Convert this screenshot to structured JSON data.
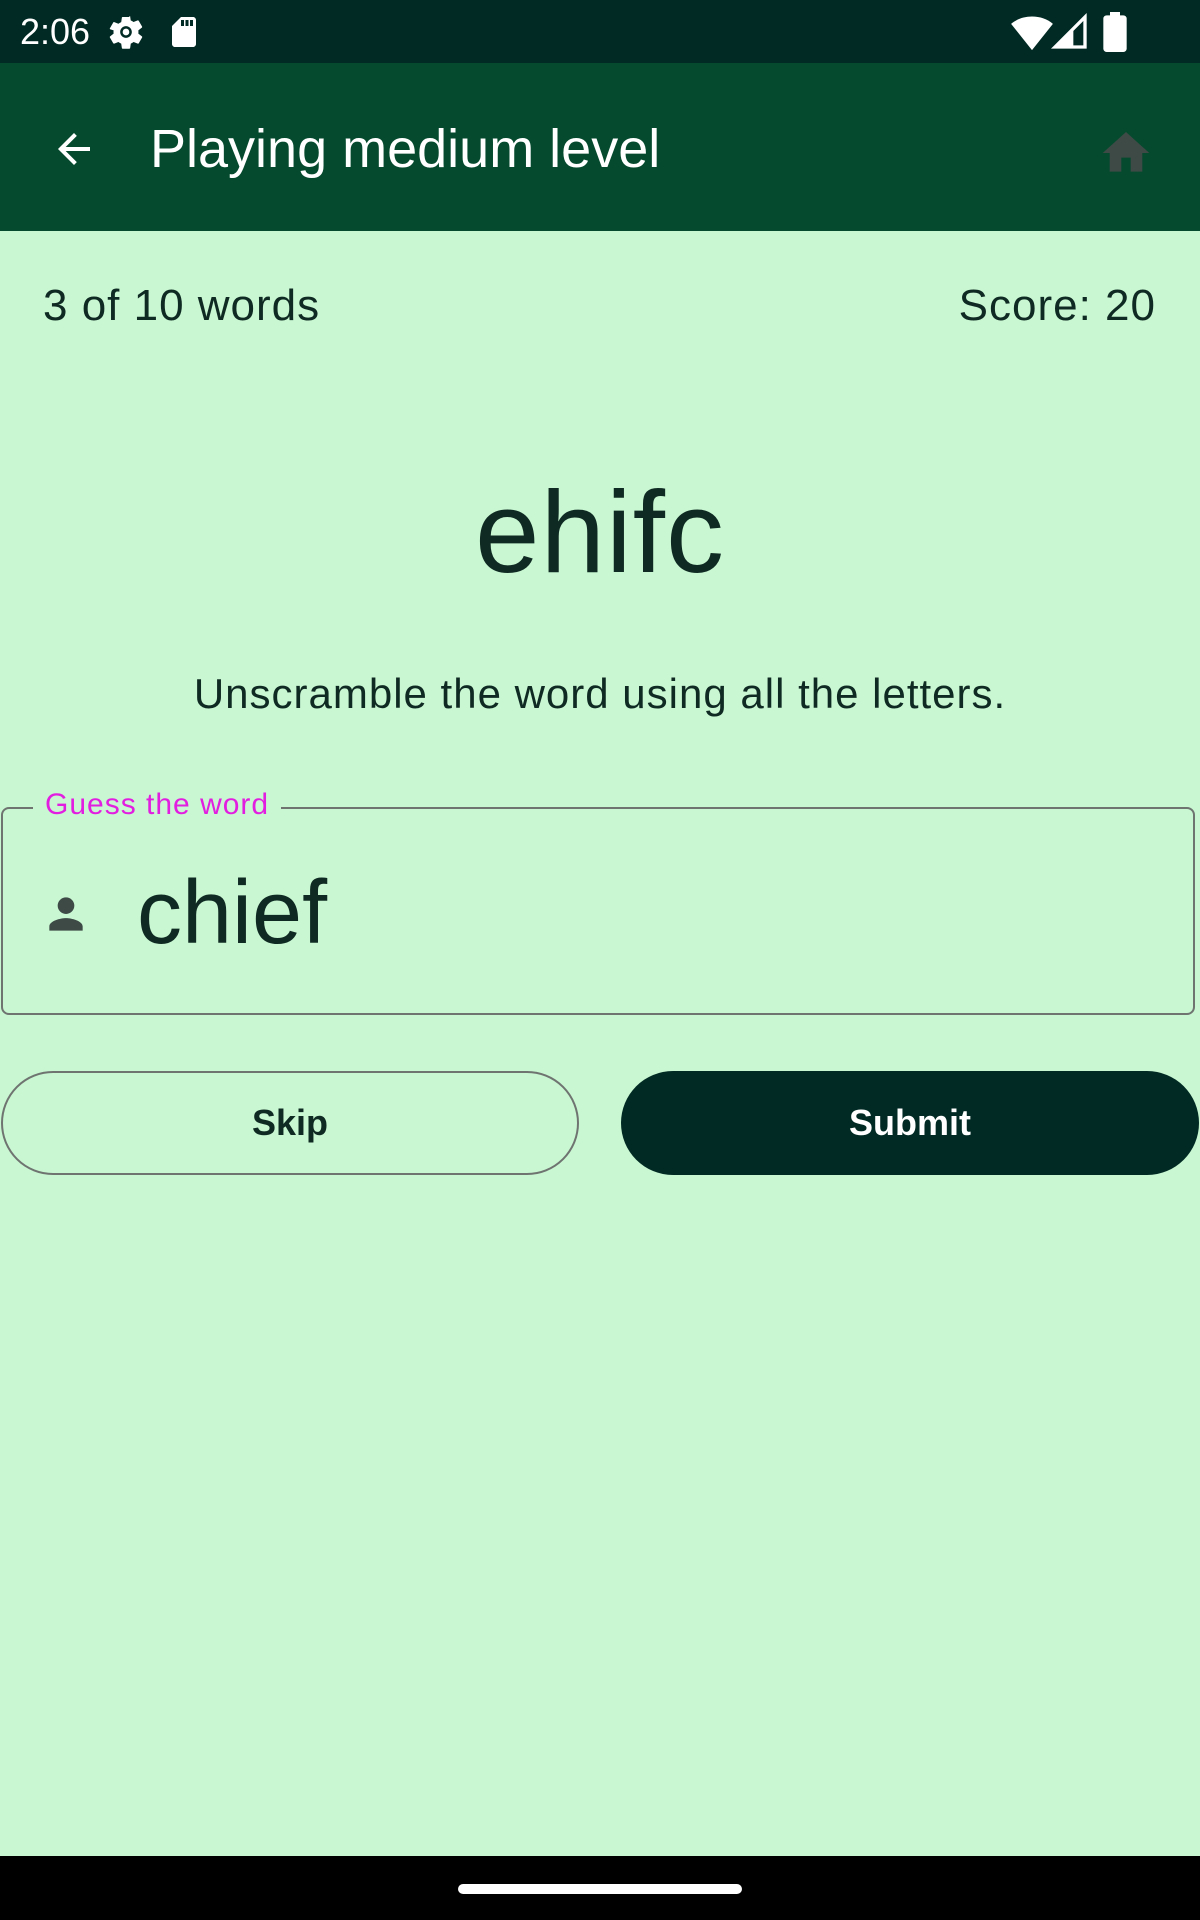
{
  "status_bar": {
    "time": "2:06",
    "icons": [
      "settings-gear-icon",
      "sd-card-icon",
      "wifi-icon",
      "signal-icon",
      "battery-icon"
    ]
  },
  "app_bar": {
    "title": "Playing medium level",
    "back_icon": "arrow-back-icon",
    "home_icon": "home-icon"
  },
  "game": {
    "progress": "3 of 10 words",
    "score": "Score: 20",
    "scrambled_word": "ehifc",
    "instructions": "Unscramble the word using all the letters."
  },
  "guess_field": {
    "label": "Guess the word",
    "value": "chief",
    "icon": "person-icon"
  },
  "buttons": {
    "skip_label": "Skip",
    "submit_label": "Submit"
  },
  "colors": {
    "background": "#c8f7d2",
    "app_bar": "#054a2e",
    "status_bar": "#002a23",
    "primary_button": "#002a23",
    "field_label": "#e21ee0"
  }
}
